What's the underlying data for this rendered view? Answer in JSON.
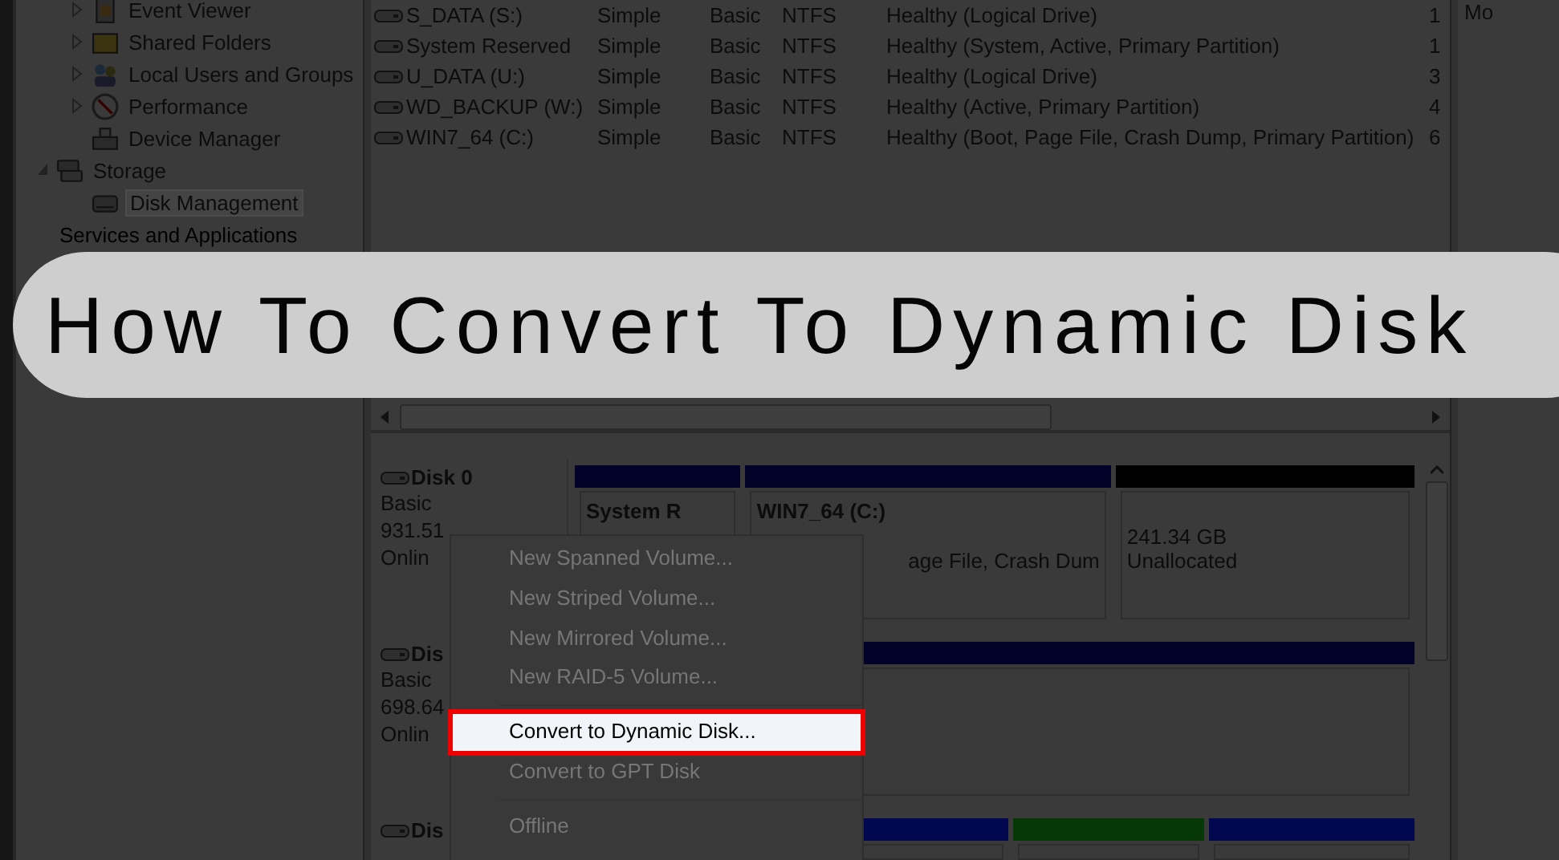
{
  "tree": {
    "items": [
      {
        "label": "Event Viewer",
        "expanded": false,
        "selected": false
      },
      {
        "label": "Shared Folders",
        "expanded": false,
        "selected": false
      },
      {
        "label": "Local Users and Groups",
        "expanded": false,
        "selected": false
      },
      {
        "label": "Performance",
        "expanded": false,
        "selected": false
      },
      {
        "label": "Device Manager",
        "selected": false
      }
    ],
    "storage": {
      "label": "Storage",
      "expanded": true,
      "children": [
        {
          "label": "Disk Management",
          "selected": true
        }
      ]
    },
    "services": {
      "label": "Services and Applications"
    }
  },
  "volumes": {
    "rows": [
      {
        "volume": "S_DATA (S:)",
        "layout": "Simple",
        "type": "Basic",
        "file_system": "NTFS",
        "status": "Healthy (Logical Drive)",
        "column_6": "1"
      },
      {
        "volume": "System Reserved",
        "layout": "Simple",
        "type": "Basic",
        "file_system": "NTFS",
        "status": "Healthy (System, Active, Primary Partition)",
        "column_6": "1"
      },
      {
        "volume": "U_DATA (U:)",
        "layout": "Simple",
        "type": "Basic",
        "file_system": "NTFS",
        "status": "Healthy (Logical Drive)",
        "column_6": "3"
      },
      {
        "volume": "WD_BACKUP (W:)",
        "layout": "Simple",
        "type": "Basic",
        "file_system": "NTFS",
        "status": "Healthy (Active, Primary Partition)",
        "column_6": "4"
      },
      {
        "volume": "WIN7_64 (C:)",
        "layout": "Simple",
        "type": "Basic",
        "file_system": "NTFS",
        "status": "Healthy (Boot, Page File, Crash Dump, Primary Partition)",
        "column_6": "6"
      }
    ]
  },
  "actions": {
    "label": "Mo"
  },
  "disks": [
    {
      "name": "Disk 0",
      "type": "Basic",
      "size": "931.51",
      "state": "Onlin",
      "partitions": [
        {
          "kind": "primary",
          "name": "System R"
        },
        {
          "kind": "primary",
          "name": "WIN7_64  (C:)",
          "info": "age File, Crash Dum"
        },
        {
          "kind": "unallocated",
          "size": "241.34 GB",
          "info": "Unallocated"
        }
      ]
    },
    {
      "name": "Dis",
      "type": "Basic",
      "size": "698.64",
      "state": "Onlin",
      "partitions": [
        {
          "kind": "primary"
        }
      ]
    },
    {
      "name": "Dis",
      "partitions": [
        {
          "kind": "primary"
        },
        {
          "kind": "logical"
        },
        {
          "kind": "free"
        },
        {
          "kind": "logical"
        }
      ]
    }
  ],
  "context_menu": {
    "items": [
      {
        "kind": "item",
        "label": "New Spanned Volume...",
        "disabled": true,
        "selected": false
      },
      {
        "kind": "item",
        "label": "New Striped Volume...",
        "disabled": true,
        "selected": false
      },
      {
        "kind": "item",
        "label": "New Mirrored Volume...",
        "disabled": true,
        "selected": false
      },
      {
        "kind": "item",
        "label": "New RAID-5 Volume...",
        "disabled": true,
        "selected": false
      },
      {
        "kind": "separator"
      },
      {
        "kind": "item",
        "label": "Convert to Dynamic Disk...",
        "disabled": false,
        "selected": true
      },
      {
        "kind": "item",
        "label": "Convert to GPT Disk",
        "disabled": true,
        "selected": false
      },
      {
        "kind": "separator"
      },
      {
        "kind": "item",
        "label": "Offline",
        "disabled": true,
        "selected": false
      }
    ]
  },
  "banner": {
    "title": "How To Convert To Dynamic Disk"
  }
}
